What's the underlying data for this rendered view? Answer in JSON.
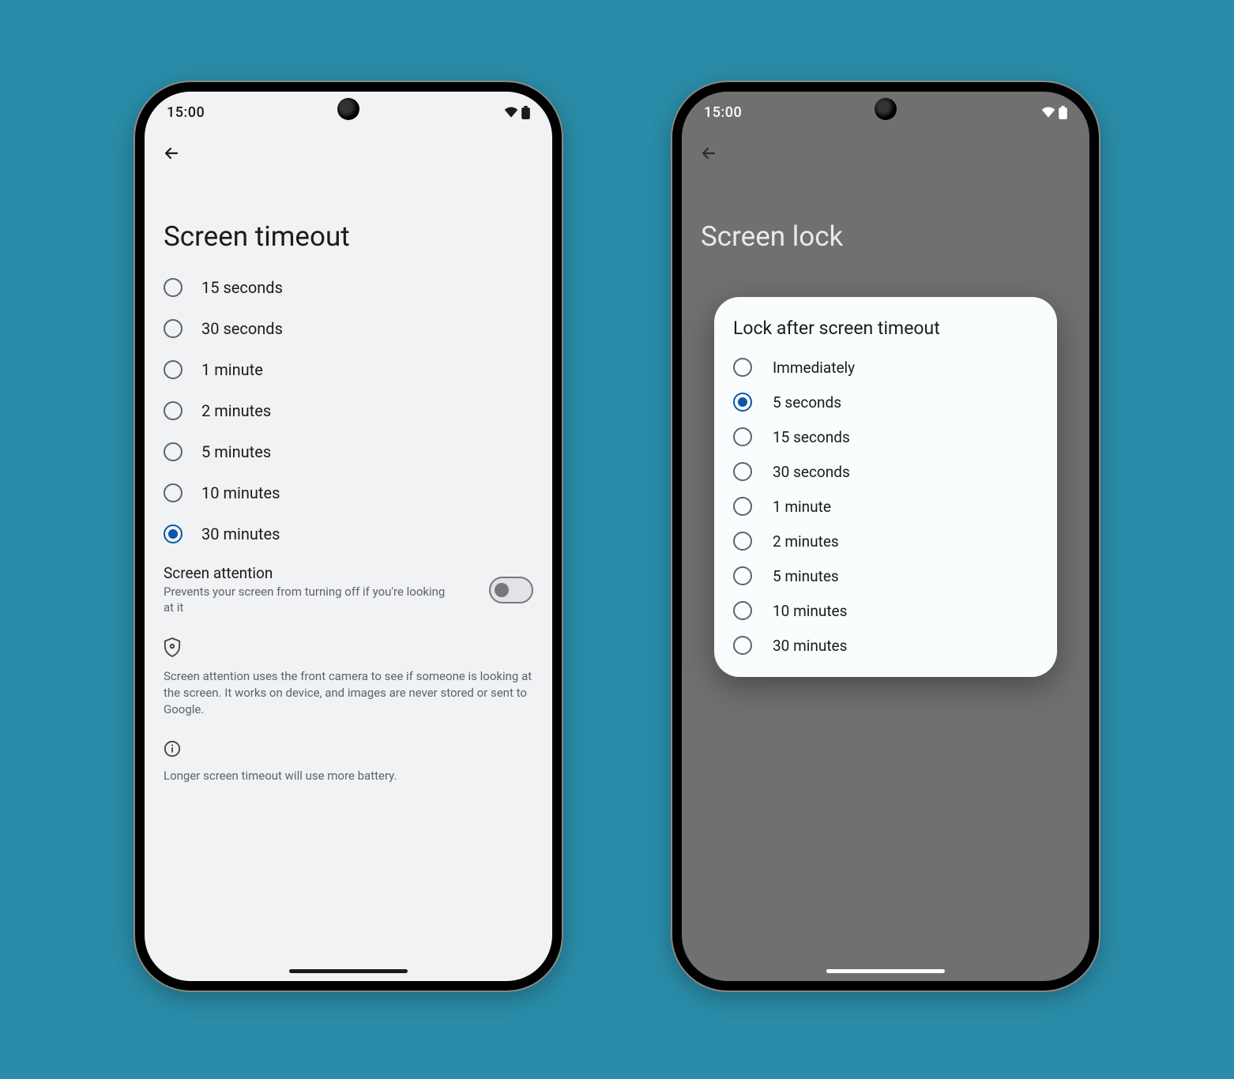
{
  "phone_left": {
    "status": {
      "time": "15:00"
    },
    "title": "Screen timeout",
    "timeout_options": [
      {
        "label": "15 seconds",
        "selected": false
      },
      {
        "label": "30 seconds",
        "selected": false
      },
      {
        "label": "1 minute",
        "selected": false
      },
      {
        "label": "2 minutes",
        "selected": false
      },
      {
        "label": "5 minutes",
        "selected": false
      },
      {
        "label": "10 minutes",
        "selected": false
      },
      {
        "label": "30 minutes",
        "selected": true
      }
    ],
    "screen_attention": {
      "title": "Screen attention",
      "subtitle": "Prevents your screen from turning off if you're looking at it",
      "enabled": false
    },
    "privacy_note": "Screen attention uses the front camera to see if someone is looking at the screen. It works on device, and images are never stored or sent to Google.",
    "footer_note": "Longer screen timeout will use more battery."
  },
  "phone_right": {
    "status": {
      "time": "15:00"
    },
    "title": "Screen lock",
    "dialog": {
      "title": "Lock after screen timeout",
      "options": [
        {
          "label": "Immediately",
          "selected": false
        },
        {
          "label": "5 seconds",
          "selected": true
        },
        {
          "label": "15 seconds",
          "selected": false
        },
        {
          "label": "30 seconds",
          "selected": false
        },
        {
          "label": "1 minute",
          "selected": false
        },
        {
          "label": "2 minutes",
          "selected": false
        },
        {
          "label": "5 minutes",
          "selected": false
        },
        {
          "label": "10 minutes",
          "selected": false
        },
        {
          "label": "30 minutes",
          "selected": false
        }
      ]
    }
  }
}
